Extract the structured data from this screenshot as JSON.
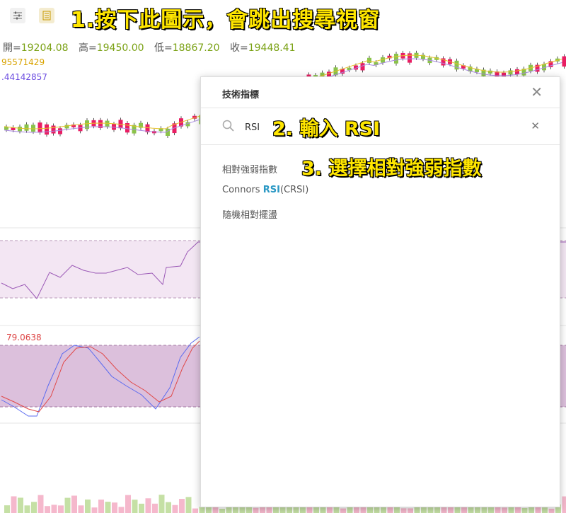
{
  "toolbar": {
    "settings_icon": "sliders-icon",
    "indicator_icon": "indicator-list-icon"
  },
  "annotations": {
    "step1": "1.按下此圖示，會跳出搜尋視窗",
    "step2": "2. 輸入 RSI",
    "step3": "3. 選擇相對強弱指數"
  },
  "ohlc": {
    "open_label": "開=",
    "open": "19204.08",
    "high_label": "高=",
    "high": "19450.00",
    "low_label": "低=",
    "low": "18867.20",
    "close_label": "收=",
    "close": "19448.41"
  },
  "ma_values": {
    "ma1": "95571429",
    "ma2": ".44142857"
  },
  "stoch_value": "79.0638",
  "colors": {
    "up": "#8bc34a",
    "down": "#e91e63",
    "ma_yellow": "#e6c229",
    "ma_purple": "#a889e0",
    "rsi_band": "#f3e6f3",
    "stoch_band": "#dcc0dc",
    "annot": "#ffe600",
    "highlight": "#2a98c4"
  },
  "dialog": {
    "title": "技術指標",
    "search_value": "RSI",
    "results": [
      {
        "pre": "相對強弱指數",
        "hl": "",
        "post": ""
      },
      {
        "pre": "Connors ",
        "hl": "RSI",
        "post": "(CRSI)"
      },
      {
        "pre": "隨機相對擺盪",
        "hl": "",
        "post": ""
      }
    ]
  }
}
